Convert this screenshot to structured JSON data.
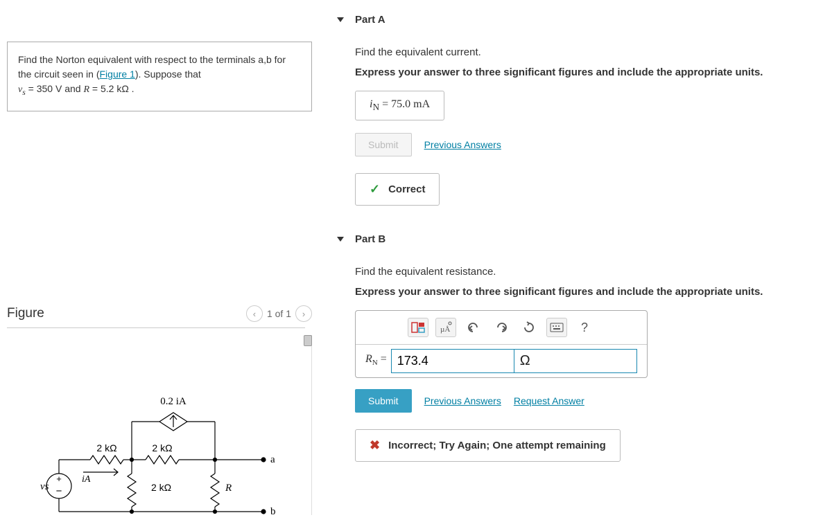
{
  "problem": {
    "intro_prefix": "Find the Norton equivalent with respect to the terminals a,b for the circuit seen in (",
    "figure_link": "Figure 1",
    "intro_suffix": "). Suppose that",
    "vs_label": "v",
    "vs_sub": "s",
    "vs_eq": " = 350  V and ",
    "r_label": "R",
    "r_eq": " = 5.2  kΩ ."
  },
  "figure": {
    "heading": "Figure",
    "pager": "1 of 1",
    "labels": {
      "dep_src": "0.2 iA",
      "r_top1": "2 kΩ",
      "r_top2": "2 kΩ",
      "r_mid": "2 kΩ",
      "R": "R",
      "ia": "iA",
      "vs": "vs",
      "a": "a",
      "b": "b"
    }
  },
  "partA": {
    "title": "Part A",
    "prompt": "Find the equivalent current.",
    "hint": "Express your answer to three significant figures and include the appropriate units.",
    "var_i": "i",
    "var_sub": "N",
    "eq": " = ",
    "value": "75.0 mA",
    "submit": "Submit",
    "prev": "Previous Answers",
    "feedback": "Correct"
  },
  "partB": {
    "title": "Part B",
    "prompt": "Find the equivalent resistance.",
    "hint": "Express your answer to three significant figures and include the appropriate units.",
    "var_R": "R",
    "var_sub": "N",
    "eq": " =",
    "value": "173.4",
    "unit": "Ω",
    "submit": "Submit",
    "prev": "Previous Answers",
    "request": "Request Answer",
    "feedback": "Incorrect; Try Again; One attempt remaining"
  },
  "toolbar": {
    "templates": "templates",
    "xup": "x-up-icon",
    "undo": "undo",
    "redo": "redo",
    "reset": "reset",
    "keyboard": "keyboard",
    "help": "?"
  }
}
